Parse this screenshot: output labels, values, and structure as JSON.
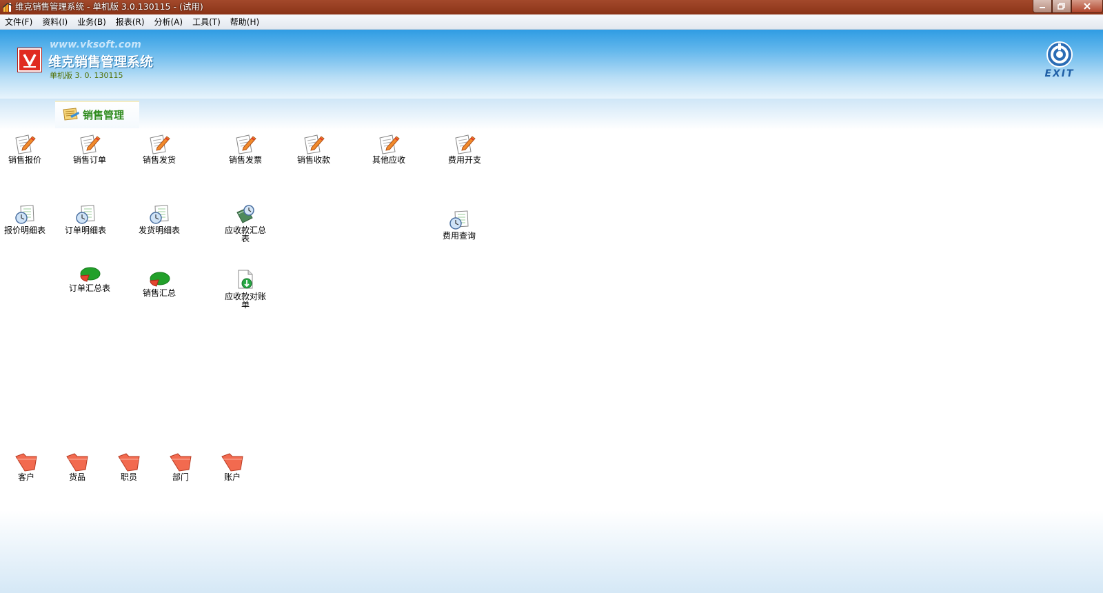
{
  "window": {
    "title": "维克销售管理系统 - 单机版 3.0.130115 - (试用)",
    "controls": [
      "minimize-icon",
      "restore-icon",
      "close-icon"
    ]
  },
  "menu": [
    "文件(F)",
    "资料(I)",
    "业务(B)",
    "报表(R)",
    "分析(A)",
    "工具(T)",
    "帮助(H)"
  ],
  "header": {
    "url": "www.vksoft.com",
    "app_name": "维克销售管理系统",
    "version": "单机版 3. 0. 130115",
    "exit_label": "EXIT"
  },
  "tab": {
    "label": "销售管理"
  },
  "documents": [
    "销售报价",
    "销售订单",
    "销售发货",
    "销售发票",
    "销售收款",
    "其他应收",
    "费用开支"
  ],
  "reports": [
    "报价明细表",
    "订单明细表",
    "发货明细表",
    "应收款汇总表",
    "费用查询"
  ],
  "summaries": [
    "订单汇总表",
    "销售汇总",
    "应收款对账单"
  ],
  "master_data": [
    "客户",
    "货品",
    "职员",
    "部门",
    "账户"
  ],
  "colors": {
    "titlebar": "#96391d",
    "header_blue": "#2f9ce3",
    "tab_label": "#2e8b1d",
    "folder": "#f26a4f",
    "pie_green": "#22a02a",
    "pie_red": "#e4462f"
  }
}
